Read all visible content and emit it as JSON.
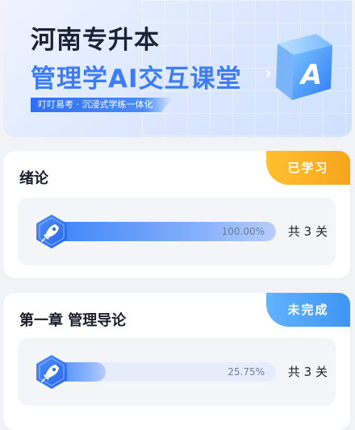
{
  "banner": {
    "title_line1": "河南专升本",
    "title_line2": "管理学AI交互课堂",
    "tagline": "叮叮易考 · 沉浸式学练一体化",
    "cube_letter": "A",
    "cube_arrow": "›",
    "accent_color": "#3d7bf7"
  },
  "courses": [
    {
      "title": "绪论",
      "status": "已学习",
      "status_color": "#f7a51b",
      "progress": 100.0,
      "progress_label": "100.00%",
      "total_label": "共 3 关",
      "icon": "rocket-icon"
    },
    {
      "title": "第一章 管理导论",
      "status": "未完成",
      "status_color": "#3f95f5",
      "progress": 25.75,
      "progress_label": "25.75%",
      "total_label": "共 3 关",
      "icon": "rocket-icon"
    }
  ]
}
